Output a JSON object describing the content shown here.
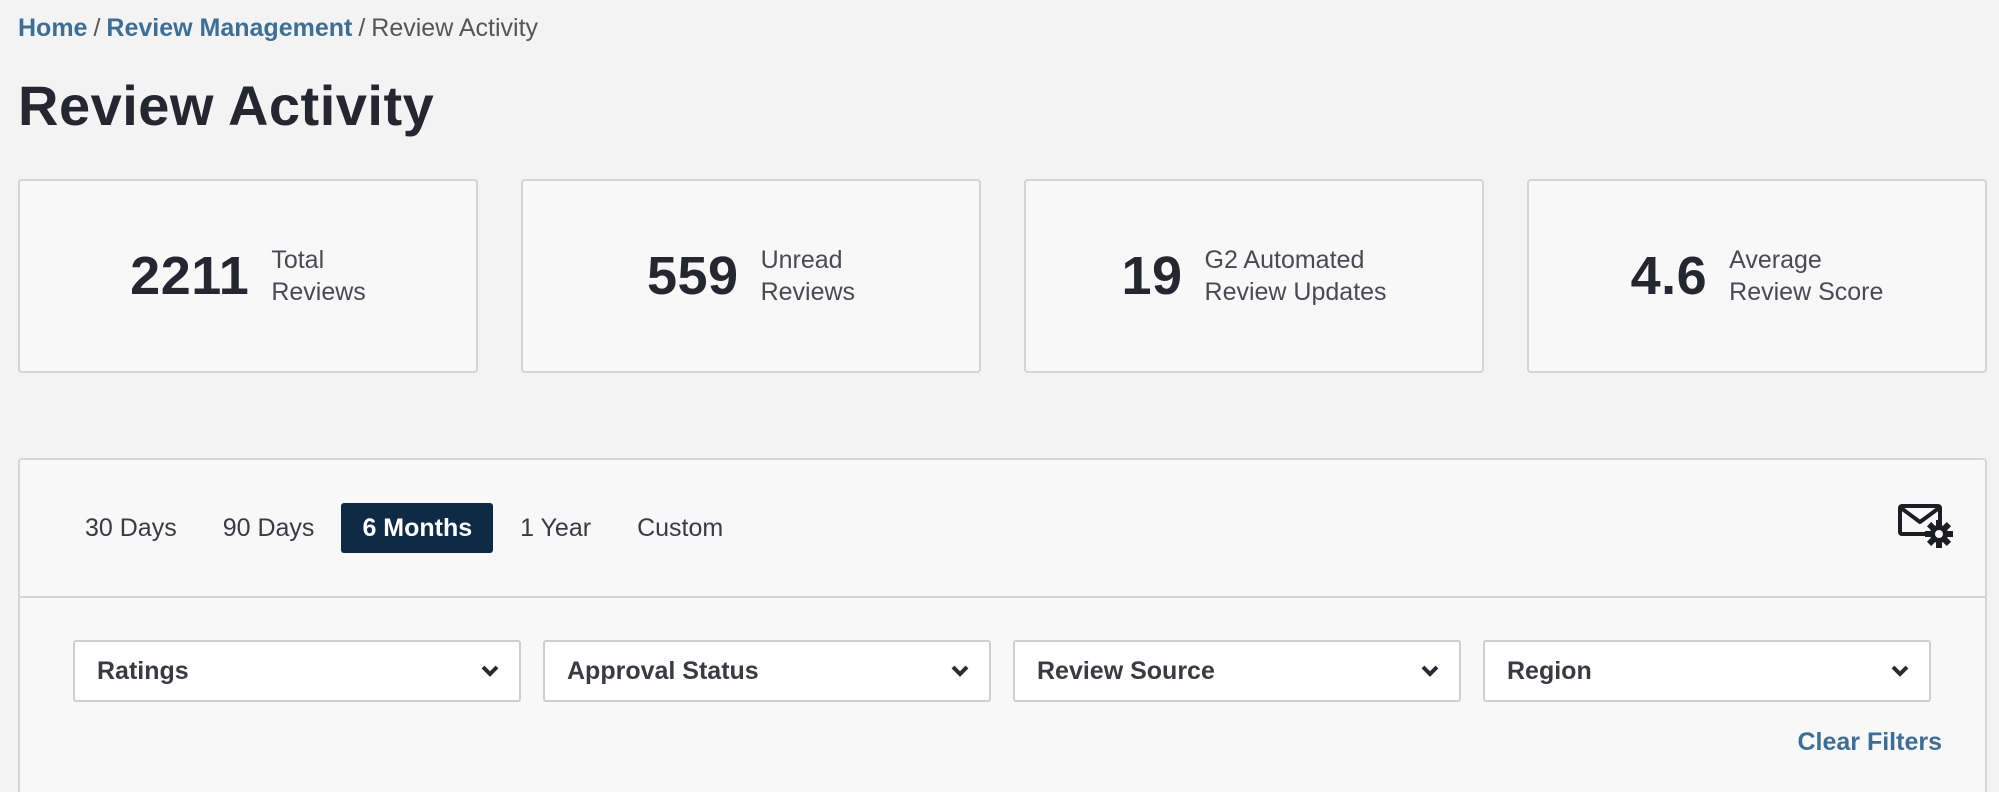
{
  "breadcrumb": {
    "home": "Home",
    "review_management": "Review Management",
    "current": "Review Activity",
    "separator": "/"
  },
  "page_title": "Review Activity",
  "stats": [
    {
      "value": "2211",
      "label_line1": "Total",
      "label_line2": "Reviews"
    },
    {
      "value": "559",
      "label_line1": "Unread",
      "label_line2": "Reviews"
    },
    {
      "value": "19",
      "label_line1": "G2 Automated",
      "label_line2": "Review Updates"
    },
    {
      "value": "4.6",
      "label_line1": "Average",
      "label_line2": "Review Score"
    }
  ],
  "range_tabs": [
    {
      "label": "30 Days"
    },
    {
      "label": "90 Days"
    },
    {
      "label": "6 Months",
      "active": true
    },
    {
      "label": "1 Year"
    },
    {
      "label": "Custom"
    }
  ],
  "filters": [
    {
      "label": "Ratings"
    },
    {
      "label": "Approval Status"
    },
    {
      "label": "Review Source"
    },
    {
      "label": "Region"
    }
  ],
  "clear_filters": "Clear Filters",
  "icons": {
    "mail_settings": "mail-settings-icon",
    "chevron": "chevron-down-icon"
  },
  "colors": {
    "accent_link": "#3d6f96",
    "active_tab": "#0f2a44",
    "background": "#f3f3f3"
  }
}
